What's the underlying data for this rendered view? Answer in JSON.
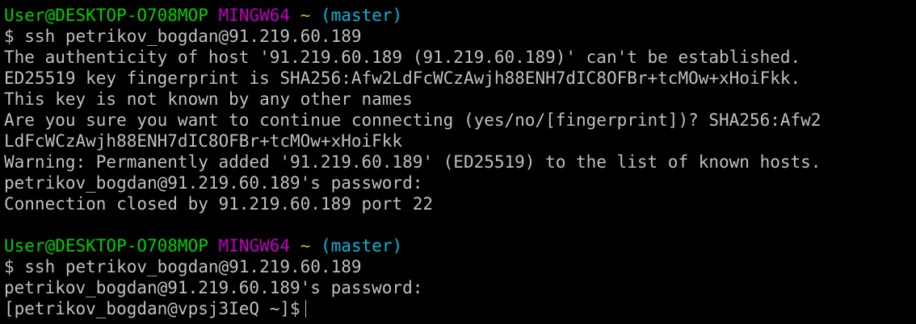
{
  "colors": {
    "background": "#000000",
    "text": "#c0c0c0",
    "user_host": "#00d000",
    "mingw": "#c000c0",
    "tilde": "#c0c000",
    "branch": "#00b8d8"
  },
  "prompt1": {
    "user_host": "User@DESKTOP-O708MOP",
    "system": "MINGW64",
    "path": "~",
    "branch": "(master)"
  },
  "output1": [
    "$ ssh petrikov_bogdan@91.219.60.189",
    "The authenticity of host '91.219.60.189 (91.219.60.189)' can't be established.",
    "ED25519 key fingerprint is SHA256:Afw2LdFcWCzAwjh88ENH7dIC8OFBr+tcMOw+xHoiFkk.",
    "This key is not known by any other names",
    "Are you sure you want to continue connecting (yes/no/[fingerprint])? SHA256:Afw2",
    "LdFcWCzAwjh88ENH7dIC8OFBr+tcMOw+xHoiFkk",
    "Warning: Permanently added '91.219.60.189' (ED25519) to the list of known hosts.",
    "petrikov_bogdan@91.219.60.189's password:",
    "Connection closed by 91.219.60.189 port 22"
  ],
  "prompt2": {
    "user_host": "User@DESKTOP-O708MOP",
    "system": "MINGW64",
    "path": "~",
    "branch": "(master)"
  },
  "output2": [
    "$ ssh petrikov_bogdan@91.219.60.189",
    "petrikov_bogdan@91.219.60.189's password:"
  ],
  "remote_prompt": "[petrikov_bogdan@vpsj3IeQ ~]$"
}
